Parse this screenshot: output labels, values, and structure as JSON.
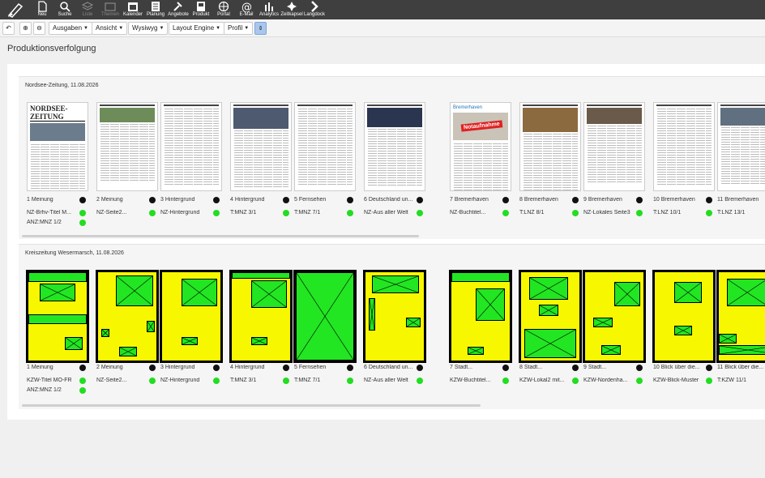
{
  "topbar": {
    "items": [
      {
        "label": "Neu",
        "icon": "new-document-icon"
      },
      {
        "label": "Suche",
        "icon": "search-icon"
      },
      {
        "label": "Liste",
        "icon": "layers-icon",
        "disabled": true
      },
      {
        "label": "Themen",
        "icon": "folder-icon",
        "disabled": true
      },
      {
        "label": "Kalender",
        "icon": "calendar-icon"
      },
      {
        "label": "Planung",
        "icon": "planning-icon"
      },
      {
        "label": "Angebote",
        "icon": "hammer-icon"
      },
      {
        "label": "Produkt",
        "icon": "product-icon"
      },
      {
        "label": "Portal",
        "icon": "globe-icon"
      },
      {
        "label": "E-Mail",
        "icon": "at-icon"
      },
      {
        "label": "Analytics",
        "icon": "analytics-icon"
      },
      {
        "label": "Zeitkapsel",
        "icon": "capsule-icon"
      },
      {
        "label": "Langdock",
        "icon": "langdock-icon"
      }
    ]
  },
  "toolbar": {
    "ausgaben": "Ausgaben",
    "ansicht": "Ansicht",
    "wysiwyg": "Wysiwyg",
    "layout_engine": "Layout Engine",
    "profil": "Profil"
  },
  "page_title": "Produktionsverfolgung",
  "colors": {
    "green": "#22dd22",
    "yellow": "#f7f700",
    "black": "#111111"
  },
  "editions": [
    {
      "title": "Nordsee-Zeitung, 11.08.2026",
      "pages": [
        {
          "label": "1 Meinung",
          "status": "black",
          "sub": [
            "NZ-Brhv-Titel M...",
            "ANZ:MNZ 1/2"
          ],
          "headline": "NORDSEE-ZEITUNG"
        },
        {
          "label": "2 Meinung",
          "status": "black",
          "sub": [
            "NZ-Seite2..."
          ],
          "headline": ""
        },
        {
          "label": "3 Hintergrund",
          "status": "black",
          "sub": [
            "NZ-Hintergrund"
          ],
          "headline": ""
        },
        {
          "label": "4 Hintergrund",
          "status": "black",
          "sub": [
            "T:MNZ 3/1"
          ],
          "headline": ""
        },
        {
          "label": "5 Fernsehen",
          "status": "black",
          "sub": [
            "T:MNZ 7/1"
          ],
          "headline": ""
        },
        {
          "label": "6 Deutschland un...",
          "status": "black",
          "sub": [
            "NZ-Aus aller Welt"
          ],
          "headline": ""
        },
        {
          "label": "7 Bremerhaven",
          "status": "black",
          "sub": [
            "NZ-Buchtitel..."
          ],
          "headline": "Bremerhaven",
          "stamp": "Notaufnahme"
        },
        {
          "label": "8 Bremerhaven",
          "status": "black",
          "sub": [
            "T:LNZ 8/1"
          ],
          "headline": ""
        },
        {
          "label": "9 Bremerhaven",
          "status": "black",
          "sub": [
            "NZ-Lokales Seite3"
          ],
          "headline": ""
        },
        {
          "label": "10 Bremerhaven",
          "status": "black",
          "sub": [
            "T:LNZ 10/1"
          ],
          "headline": ""
        },
        {
          "label": "11 Bremerhaven",
          "status": "black",
          "sub": [
            "T:LNZ 13/1"
          ],
          "headline": ""
        }
      ]
    },
    {
      "title": "Kreiszeitung Wesermarsch, 11.08.2026",
      "pages": [
        {
          "label": "1 Meinung",
          "status": "black",
          "sub": [
            "KZW-Titel MO-FR",
            "ANZ:MNZ 1/2"
          ]
        },
        {
          "label": "2 Meinung",
          "status": "black",
          "sub": [
            "NZ-Seite2..."
          ]
        },
        {
          "label": "3 Hintergrund",
          "status": "black",
          "sub": [
            "NZ-Hintergrund"
          ]
        },
        {
          "label": "4 Hintergrund",
          "status": "black",
          "sub": [
            "T:MNZ 3/1"
          ]
        },
        {
          "label": "5 Fernsehen",
          "status": "black",
          "sub": [
            "T:MNZ 7/1"
          ]
        },
        {
          "label": "6 Deutschland un...",
          "status": "black",
          "sub": [
            "NZ-Aus aller Welt"
          ]
        },
        {
          "label": "7 Stadt...",
          "status": "black",
          "sub": [
            "KZW-Buchtitel..."
          ]
        },
        {
          "label": "8 Stadt...",
          "status": "black",
          "sub": [
            "KZW-Lokal2 mit..."
          ]
        },
        {
          "label": "9 Stadt...",
          "status": "black",
          "sub": [
            "KZW-Nordenha..."
          ]
        },
        {
          "label": "10 Blick über die...",
          "status": "black",
          "sub": [
            "KZW-Blick-Muster"
          ]
        },
        {
          "label": "11 Blick über die...",
          "status": "black",
          "sub": [
            "T:KZW 11/1"
          ]
        }
      ]
    }
  ]
}
